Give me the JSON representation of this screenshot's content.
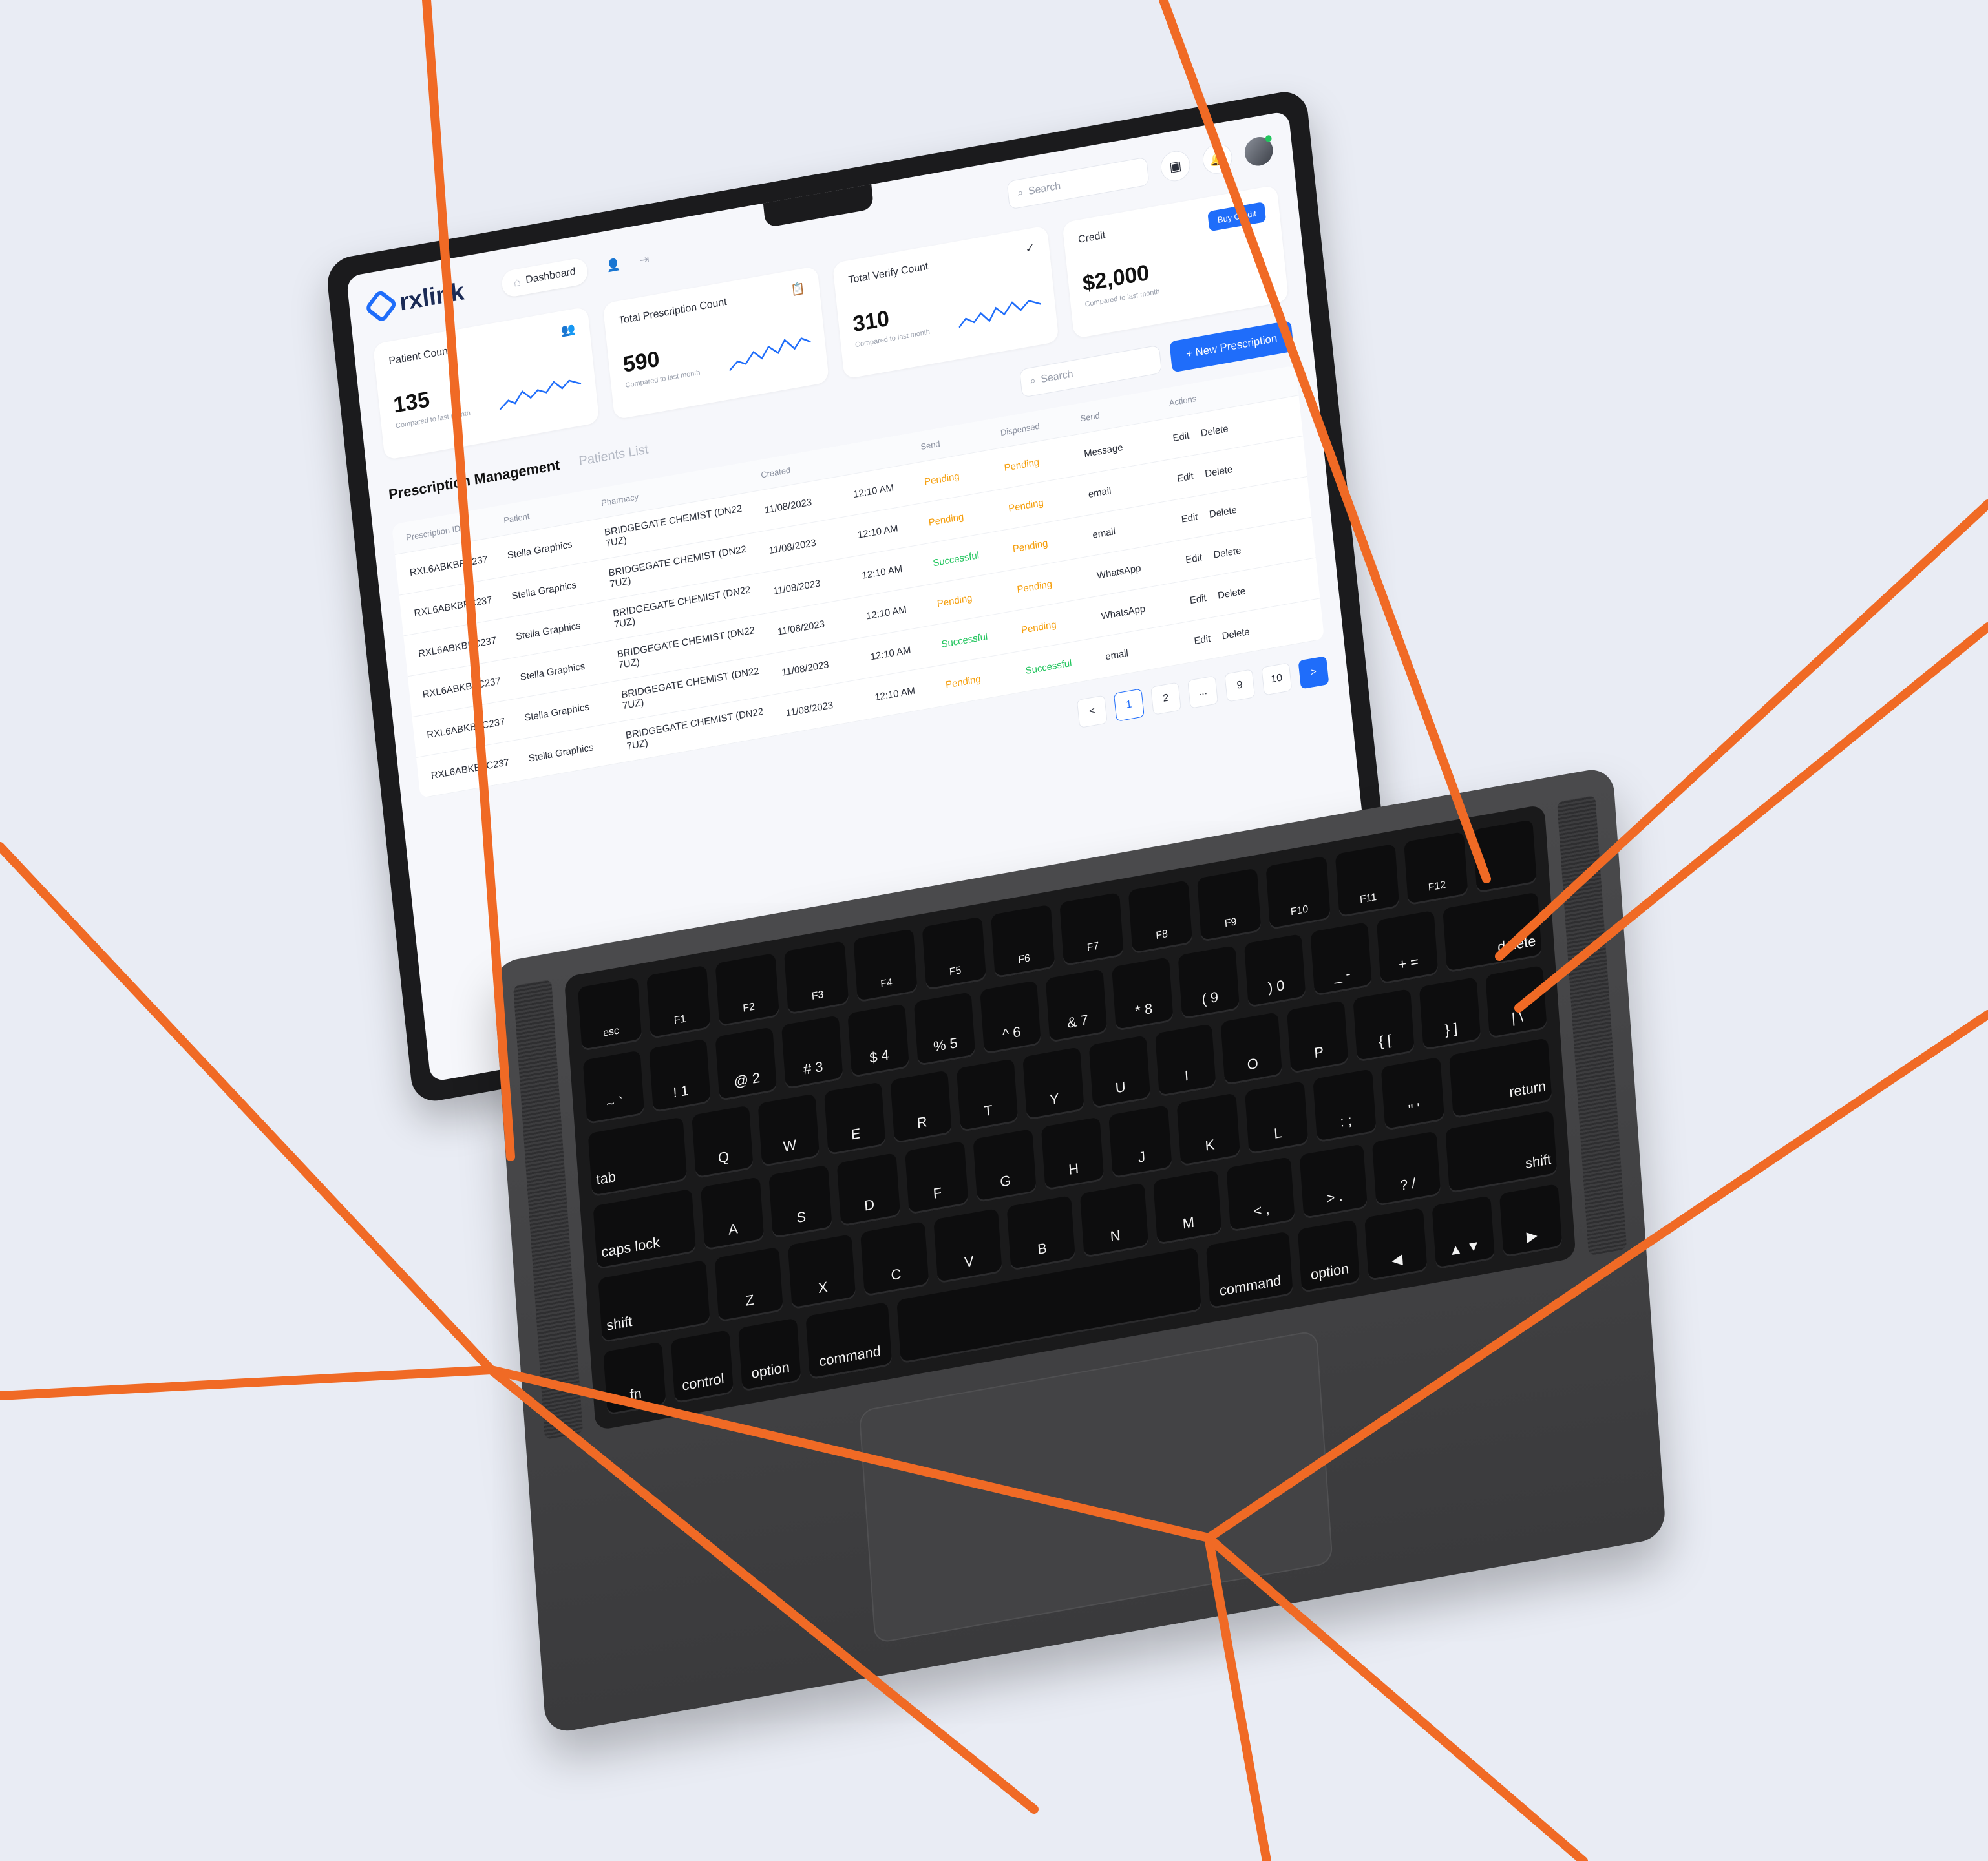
{
  "app": {
    "logo_text": "rxlink",
    "nav": [
      {
        "label": "Dashboard",
        "icon": "home-icon"
      },
      {
        "label": "",
        "icon": "user-icon"
      },
      {
        "label": "",
        "icon": "logout-icon"
      }
    ],
    "search_placeholder": "Search",
    "cards": [
      {
        "title": "Patient Count",
        "value": "135",
        "sub": "Compared to last month",
        "icon": "users-icon"
      },
      {
        "title": "Total Prescription Count",
        "value": "590",
        "sub": "Compared to last month",
        "icon": "clipboard-icon"
      },
      {
        "title": "Total Verify Count",
        "value": "310",
        "sub": "Compared to last month",
        "icon": "verify-icon"
      },
      {
        "title": "Credit",
        "value": "$2,000",
        "sub": "Compared to last month",
        "button": "Buy Credit"
      }
    ],
    "section": {
      "tab_active": "Prescription Management",
      "tab_inactive": "Patients List",
      "search_placeholder": "Search",
      "new_button": "+ New Prescription"
    },
    "table": {
      "headers": [
        "Prescription ID",
        "Patient",
        "Pharmacy",
        "Created",
        "",
        "Send",
        "Dispensed",
        "Send",
        "Actions"
      ],
      "rows": [
        [
          "RXL6ABKBFC237",
          "Stella Graphics",
          "BRIDGEGATE CHEMIST (DN22 7UZ)",
          "11/08/2023",
          "12:10 AM",
          "Pending",
          "Pending",
          "Message",
          "Edit",
          "Delete"
        ],
        [
          "RXL6ABKBFC237",
          "Stella Graphics",
          "BRIDGEGATE CHEMIST (DN22 7UZ)",
          "11/08/2023",
          "12:10 AM",
          "Pending",
          "Pending",
          "email",
          "Edit",
          "Delete"
        ],
        [
          "RXL6ABKBFC237",
          "Stella Graphics",
          "BRIDGEGATE CHEMIST (DN22 7UZ)",
          "11/08/2023",
          "12:10 AM",
          "Successful",
          "Pending",
          "email",
          "Edit",
          "Delete"
        ],
        [
          "RXL6ABKBFC237",
          "Stella Graphics",
          "BRIDGEGATE CHEMIST (DN22 7UZ)",
          "11/08/2023",
          "12:10 AM",
          "Pending",
          "Pending",
          "WhatsApp",
          "Edit",
          "Delete"
        ],
        [
          "RXL6ABKBFC237",
          "Stella Graphics",
          "BRIDGEGATE CHEMIST (DN22 7UZ)",
          "11/08/2023",
          "12:10 AM",
          "Successful",
          "Pending",
          "WhatsApp",
          "Edit",
          "Delete"
        ],
        [
          "RXL6ABKBFC237",
          "Stella Graphics",
          "BRIDGEGATE CHEMIST (DN22 7UZ)",
          "11/08/2023",
          "12:10 AM",
          "Pending",
          "Successful",
          "email",
          "Edit",
          "Delete"
        ]
      ]
    },
    "pagination": [
      "<",
      "1",
      "2",
      "...",
      "9",
      "10",
      ">"
    ],
    "colors": {
      "accent": "#1f6dfa",
      "pending": "#f59e0b",
      "success": "#22c55e",
      "rope": "#f06a25"
    }
  },
  "keyboard": {
    "rows": [
      [
        "esc",
        "F1",
        "F2",
        "F3",
        "F4",
        "F5",
        "F6",
        "F7",
        "F8",
        "F9",
        "F10",
        "F11",
        "F12",
        ""
      ],
      [
        "~ `",
        "! 1",
        "@ 2",
        "# 3",
        "$ 4",
        "% 5",
        "^ 6",
        "& 7",
        "* 8",
        "( 9",
        ") 0",
        "_ -",
        "+ =",
        "delete"
      ],
      [
        "tab",
        "Q",
        "W",
        "E",
        "R",
        "T",
        "Y",
        "U",
        "I",
        "O",
        "P",
        "{ [",
        "} ]",
        "| \\"
      ],
      [
        "caps lock",
        "A",
        "S",
        "D",
        "F",
        "G",
        "H",
        "J",
        "K",
        "L",
        ": ;",
        "\" '",
        "return"
      ],
      [
        "shift",
        "Z",
        "X",
        "C",
        "V",
        "B",
        "N",
        "M",
        "< ,",
        "> .",
        "? /",
        "shift"
      ],
      [
        "fn",
        "control",
        "option",
        "command",
        "",
        "command",
        "option",
        "◀",
        "▲ ▼",
        "▶"
      ]
    ]
  }
}
